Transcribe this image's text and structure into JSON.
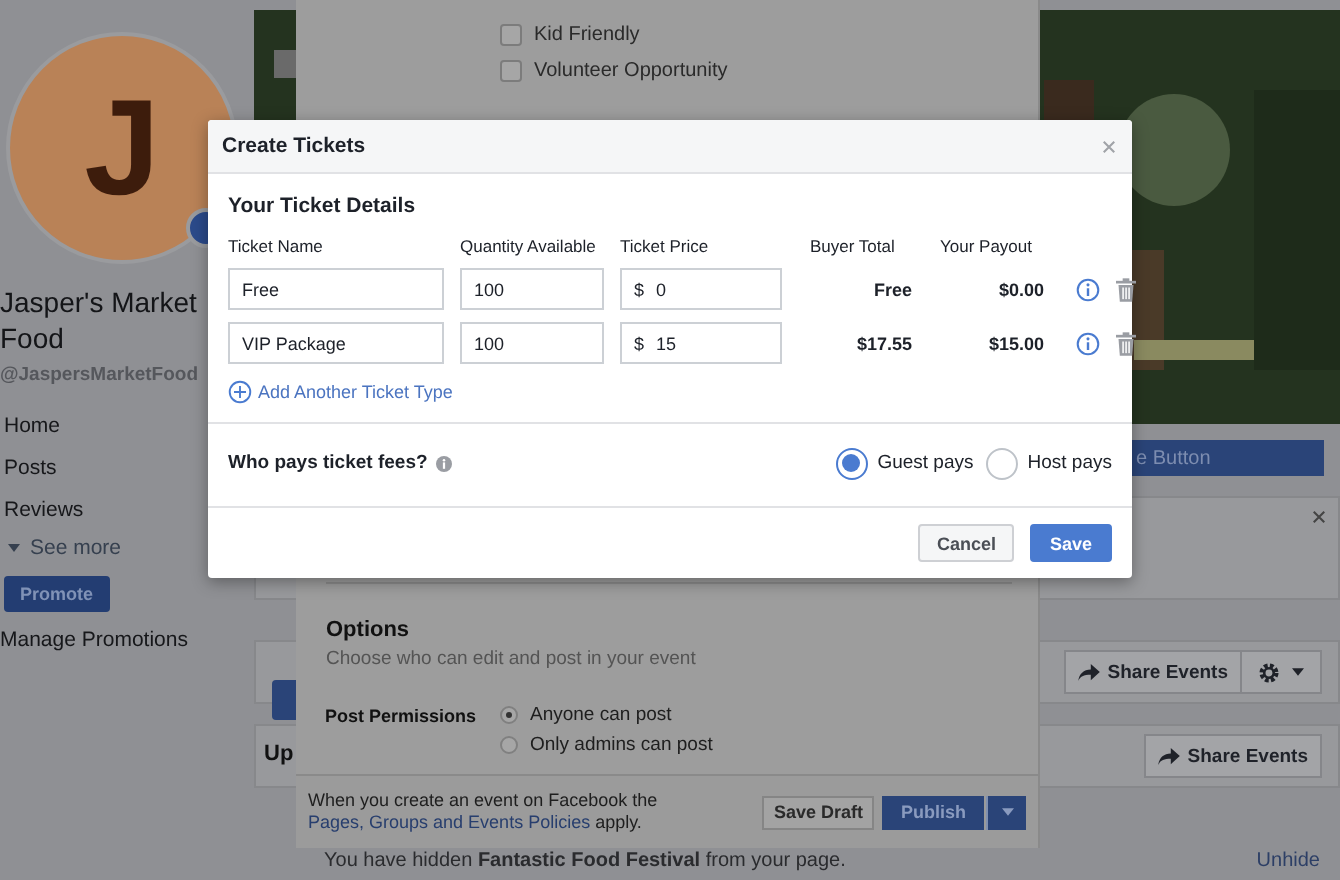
{
  "sidebar": {
    "avatar_initial": "J",
    "name": "Jasper's Market Food",
    "handle": "@JaspersMarketFood",
    "nav": [
      {
        "label": "Home"
      },
      {
        "label": "Posts"
      },
      {
        "label": "Reviews"
      }
    ],
    "see_more": "See more",
    "promote_button": "Promote",
    "manage_link": "Manage Promotions"
  },
  "main": {
    "cover": {
      "kind": "picture"
    },
    "action_button": "e Button",
    "share_buttons": [
      "Share Events",
      "Share Events"
    ],
    "section_heading": "Up",
    "hidden_notice": "You have hidden **Fantastic Food Festival** from your page.",
    "unhide_link": "Unhide"
  },
  "event_editor": {
    "checkboxes": [
      {
        "label": "Kid Friendly",
        "checked": false
      },
      {
        "label": "Volunteer Opportunity",
        "checked": false
      }
    ],
    "options_title": "Options",
    "options_hint": "Choose who can edit and post in your event",
    "permissions_label": "Post Permissions",
    "permissions": [
      {
        "label": "Anyone can post",
        "selected": true
      },
      {
        "label": "Only admins can post",
        "selected": false
      }
    ],
    "policy_text": "When you create an event on Facebook the",
    "policy_link": "Pages, Groups and Events Policies",
    "policy_end": "apply.",
    "save_draft": "Save Draft",
    "publish": "Publish"
  },
  "dialog": {
    "title": "Create Tickets",
    "section_title": "Your Ticket Details",
    "columns": [
      "Ticket Name",
      "Quantity Available",
      "Ticket Price",
      "Buyer Total",
      "Your Payout"
    ],
    "tickets": [
      {
        "name": "Free",
        "quantity": "100",
        "currency": "$",
        "price": "0",
        "buyer_total": "Free",
        "payout": "$0.00"
      },
      {
        "name": "VIP Package",
        "quantity": "100",
        "currency": "$",
        "price": "15",
        "buyer_total": "$17.55",
        "payout": "$15.00"
      }
    ],
    "add_link": "Add Another Ticket Type",
    "fees_question": "Who pays ticket fees?",
    "fee_options": [
      {
        "label": "Guest pays",
        "selected": true
      },
      {
        "label": "Host pays",
        "selected": false
      }
    ],
    "cancel": "Cancel",
    "save": "Save"
  }
}
